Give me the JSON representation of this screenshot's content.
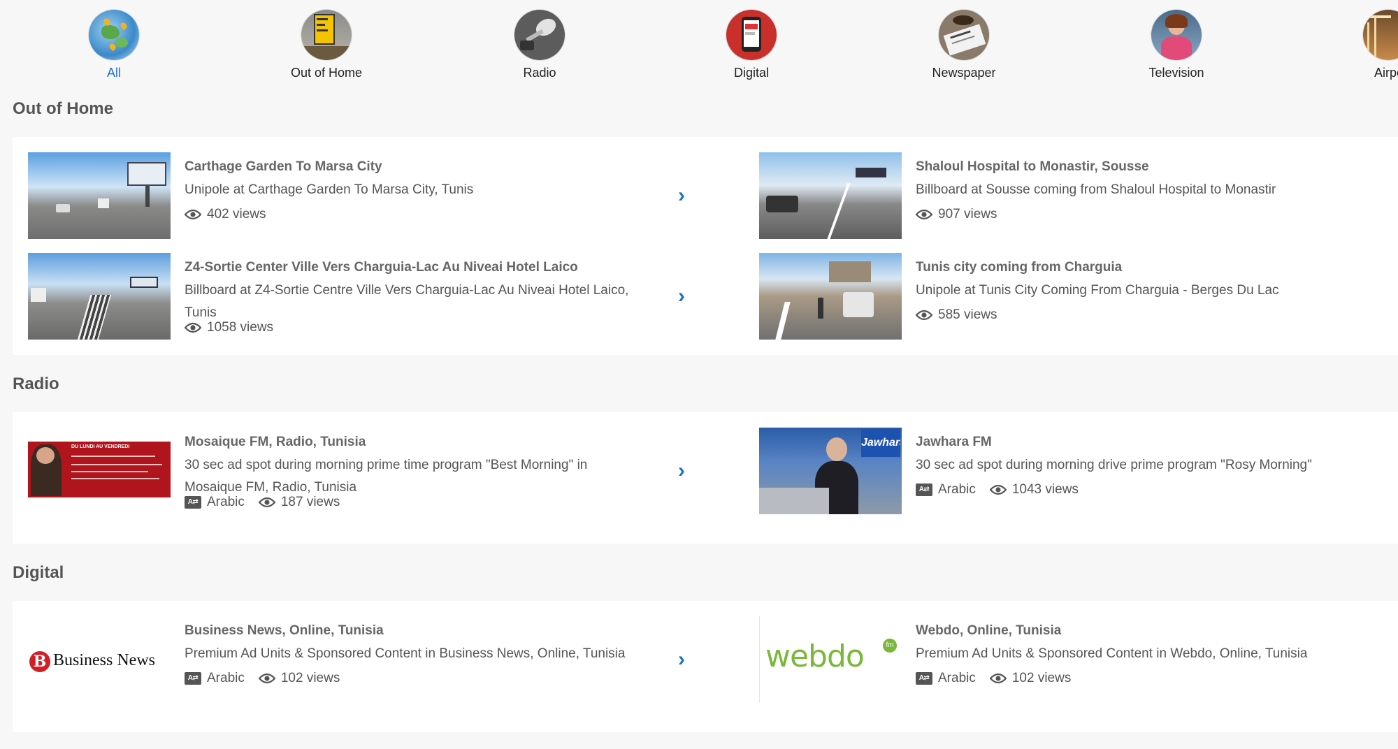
{
  "categories": [
    {
      "label": "All",
      "icon": "globe-icon",
      "active": true
    },
    {
      "label": "Out of Home",
      "icon": "billboard-icon"
    },
    {
      "label": "Radio",
      "icon": "microphone-icon"
    },
    {
      "label": "Digital",
      "icon": "phone-icon"
    },
    {
      "label": "Newspaper",
      "icon": "newspaper-icon"
    },
    {
      "label": "Television",
      "icon": "tv-presenter-icon"
    },
    {
      "label": "Airports",
      "icon": "airport-icon"
    }
  ],
  "sections": [
    {
      "title": "Out of Home",
      "items": [
        {
          "title": "Carthage Garden To Marsa City",
          "desc": "Unipole at Carthage Garden To Marsa City, Tunis",
          "views": "402 views"
        },
        {
          "title": "Shaloul Hospital to Monastir, Sousse",
          "desc": "Billboard at Sousse coming from Shaloul Hospital to Monastir",
          "views": "907 views"
        },
        {
          "title": "Z4-Sortie Center Ville Vers Charguia-Lac Au Niveai Hotel Laico",
          "desc": "Billboard at Z4-Sortie Centre Ville Vers Charguia-Lac Au Niveai Hotel Laico, Tunis",
          "views": "1058 views"
        },
        {
          "title": "Tunis city coming from Charguia",
          "desc": "Unipole at Tunis City Coming From Charguia - Berges Du Lac",
          "views": "585 views"
        }
      ]
    },
    {
      "title": "Radio",
      "items": [
        {
          "title": "Mosaique FM, Radio, Tunisia",
          "desc": "30 sec ad spot during morning prime time program \"Best Morning\" in Mosaique FM, Radio, Tunisia",
          "lang": "Arabic",
          "views": "187 views"
        },
        {
          "title": "Jawhara FM",
          "desc": "30 sec ad spot during morning drive prime program \"Rosy Morning\"",
          "lang": "Arabic",
          "views": "1043 views"
        }
      ]
    },
    {
      "title": "Digital",
      "items": [
        {
          "title": "Business News, Online, Tunisia",
          "desc": "Premium Ad Units & Sponsored Content in Business News, Online, Tunisia",
          "lang": "Arabic",
          "views": "102 views"
        },
        {
          "title": "Webdo, Online, Tunisia",
          "desc": "Premium Ad Units & Sponsored Content in Webdo, Online, Tunisia",
          "lang": "Arabic",
          "views": "102 views"
        }
      ]
    }
  ],
  "logos": {
    "business_news": "Business News",
    "webdo": "webdo",
    "webdo_badge": "fm",
    "jawhara": "Jawhara",
    "mosaique_banner": "DU LUNDI AU VENDREDI"
  },
  "icons": {
    "views": "eye-icon",
    "language": "translate-icon",
    "next": "chevron-right-icon"
  },
  "colors": {
    "accent": "#1a73c8",
    "background": "#f7f7f7",
    "panel": "#ffffff",
    "text": "#555555"
  }
}
